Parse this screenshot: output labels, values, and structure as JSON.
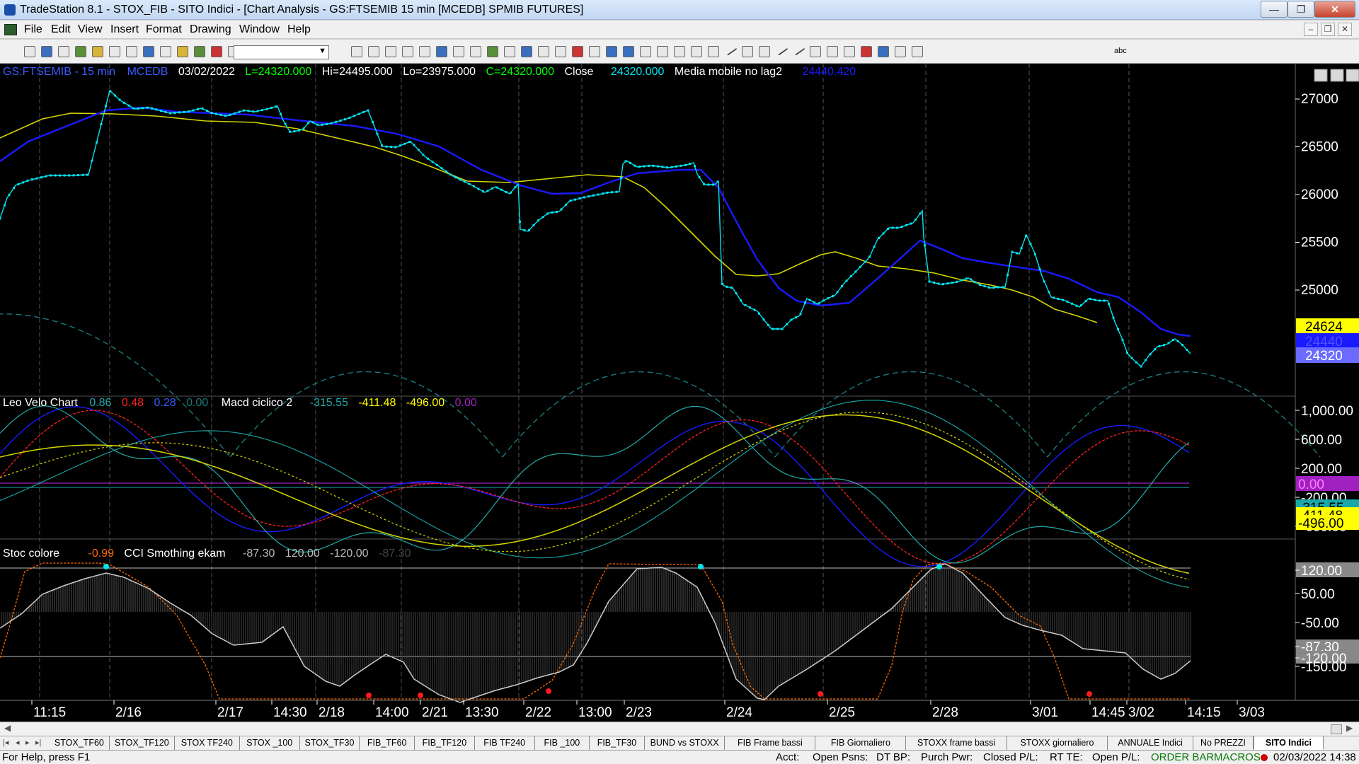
{
  "window": {
    "title": "TradeStation 8.1 - STOX_FIB - SITO Indici - [Chart Analysis - GS:FTSEMIB  15 min  [MCEDB] SPMIB FUTURES]",
    "minimize": "—",
    "maximize": "❐",
    "close": "✕"
  },
  "menu": {
    "items": [
      "File",
      "Edit",
      "View",
      "Insert",
      "Format",
      "Drawing",
      "Window",
      "Help"
    ],
    "mdi": [
      "–",
      "❐",
      "✕"
    ]
  },
  "toolbar": {
    "icons": [
      "new-file-icon",
      "open-icon",
      "open-workspace-icon",
      "new-workspace-icon",
      "save-icon",
      "print-preview-icon",
      "print-icon",
      "chart-window-icon",
      "radar-window-icon",
      "lock-icon",
      "macro-icon",
      "strategy-icon",
      "symbol-combo-arrow",
      "go-icon",
      "find-icon",
      "bar-spacing-icon",
      "tick-icon",
      "table-icon",
      "crosshair-chart-icon",
      "compress-icon",
      "expand-icon",
      "tool-a-icon",
      "tool-b-icon",
      "insert-icon",
      "insert-indicator-icon",
      "timeframe-icon",
      "candle-icon",
      "scale-icon",
      "zoom-in-icon",
      "zoom-out-icon",
      "pointer-icon",
      "select-icon",
      "format-icon",
      "hand-icon",
      "export-icon",
      "trendline-icon",
      "horizontal-line-icon",
      "vertical-line-icon",
      "fib-icon",
      "channel-icon",
      "arc-icon",
      "ellipse-icon",
      "text-icon",
      "up-arrow-icon",
      "down-arrow-icon",
      "circle-icon",
      "rectangle-icon"
    ],
    "symbol_value": "",
    "text_tool": "abc"
  },
  "colors": {
    "price": "#00e5f0",
    "ma_blue": "#1a1aff",
    "ma_yellow": "#d4d400",
    "cycle": "#1a7a7a",
    "info_blue": "#3a5cff",
    "info_green": "#00ff00",
    "macd_red": "#ff2020",
    "purple": "#a020c0",
    "orange_dots": "#ff6a00"
  },
  "chart": {
    "price_header": {
      "symbol": "GS:FTSEMIB - 15 min",
      "source": "MCEDB",
      "date": "03/02/2022",
      "low_close": "L=24320.000",
      "hi": "Hi=24495.000",
      "lo": "Lo=23975.000",
      "c": "C=24320.000",
      "close_label": "Close",
      "close_value": "24320.000",
      "ma_label": "Media mobile no lag2",
      "ma_value": "24440.420"
    },
    "price_axis": [
      "27000",
      "26500",
      "26000",
      "25500",
      "25000"
    ],
    "price_tags": [
      {
        "text": "24624",
        "bg": "#ffff00",
        "fg": "#000"
      },
      {
        "text": "24440",
        "bg": "#1a1aff",
        "fg": "#5050ff"
      },
      {
        "text": "24320",
        "bg": "#6b6bff",
        "fg": "#fff"
      }
    ],
    "osc_header": {
      "name": "Leo Velo Chart",
      "v1": "0.86",
      "v2": "0.48",
      "v3": "0.28",
      "v4": "0.00",
      "name2": "Macd ciclico 2",
      "v5": "-315.55",
      "v6": "-411.48",
      "v7": "-496.00",
      "v8": "0.00"
    },
    "osc_axis": [
      "1,000.00",
      "600.00",
      "200.00",
      "-200.00",
      "-600.00"
    ],
    "osc_tags": [
      {
        "text": "0.00",
        "bg": "#a020c0",
        "fg": "#ff80ff"
      },
      {
        "text": "-315.55",
        "bg": "#1aa8a8",
        "fg": "#000"
      },
      {
        "text": "-411.48",
        "bg": "#ffff00",
        "fg": "#000"
      },
      {
        "text": "-496.00",
        "bg": "#ffff00",
        "fg": "#000"
      }
    ],
    "stoc_header": {
      "name": "Stoc colore",
      "v1": "-0.99",
      "name2": "CCI Smothing ekam",
      "v2": "-87.30",
      "v3": "120.00",
      "v4": "-120.00",
      "v5": "-87.30"
    },
    "stoc_axis": [
      "120.00",
      "50.00",
      "-50.00",
      "-87.30",
      "-120.00",
      "-150.00"
    ],
    "time_axis": [
      "11:15",
      "2/16",
      "2/17",
      "14:30",
      "2/18",
      "14:00",
      "2/21",
      "13:30",
      "2/22",
      "13:00",
      "2/23",
      "2/24",
      "2/25",
      "2/28",
      "3/01",
      "14:45",
      "3/02",
      "14:15",
      "3/03"
    ]
  },
  "tabs": [
    "STOX_TF60",
    "STOX_TF120",
    "STOX TF240",
    "STOX _100",
    "STOX_TF30",
    "FIB_TF60",
    "FIB_TF120",
    "FIB TF240",
    "FIB _100",
    "FIB_TF30",
    "BUND vs STOXX",
    "FIB Frame bassi",
    "FIB Giornaliero",
    "STOXX frame bassi",
    "STOXX giornaliero",
    "ANNUALE Indici",
    "No PREZZI",
    "SITO Indici"
  ],
  "tab_nav": [
    "|◂",
    "◂",
    "▸",
    "▸|"
  ],
  "status": {
    "help": "For Help, press F1",
    "acct": "Acct:",
    "open_psns": "Open Psns:",
    "dt_bp": "DT BP:",
    "purch_pwr": "Purch Pwr:",
    "closed_pl": "Closed P/L:",
    "rt_te": "RT TE:",
    "open_pl": "Open P/L:",
    "order_bar": "ORDER BAR",
    "macros": "MACROS",
    "datetime": "02/03/2022 14:38"
  }
}
